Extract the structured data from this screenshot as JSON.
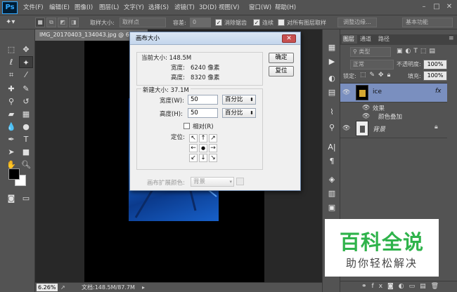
{
  "app": {
    "logo": "Ps"
  },
  "menu": [
    "文件(F)",
    "编辑(E)",
    "图像(I)",
    "图层(L)",
    "文字(Y)",
    "选择(S)",
    "滤镜(T)",
    "3D(D)",
    "视图(V)",
    "窗口(W)",
    "帮助(H)"
  ],
  "window_controls": [
    "–",
    "□",
    "✕"
  ],
  "options": {
    "sample_size_label": "取样大小:",
    "sample_size_value": "取样点",
    "tolerance_label": "容差:",
    "tolerance_value": "0",
    "antialias_label": "消除锯齿",
    "contiguous_label": "连续",
    "all_layers_label": "对所有图层取样",
    "refine_edge": "调整边缘...",
    "workspace": "基本功能"
  },
  "document": {
    "tab_title": "IMG_20170403_134043.jpg @ 6.26%",
    "zoom": "6.26%",
    "doc_info": "文档:148.5M/87.7M"
  },
  "dialog": {
    "title": "画布大小",
    "current_size_label": "当前大小: 148.5M",
    "width_label": "宽度:",
    "width_value": "6240 像素",
    "height_label": "高度:",
    "height_value": "8320 像素",
    "new_size_label": "新建大小: 37.1M",
    "new_width_label": "宽度(W):",
    "new_width_value": "50",
    "new_width_unit": "百分比",
    "new_height_label": "高度(H):",
    "new_height_value": "50",
    "new_height_unit": "百分比",
    "relative_label": "相对(R)",
    "anchor_label": "定位:",
    "anchor_arrows": [
      "↖",
      "↑",
      "↗",
      "←",
      "●",
      "→",
      "↙",
      "↓",
      "↘"
    ],
    "ext_color_label": "画布扩展颜色:",
    "ext_color_value": "背景",
    "ok": "确定",
    "reset": "复位"
  },
  "layers_panel": {
    "tabs": [
      "图层",
      "通道",
      "路径"
    ],
    "filter_kind": "类型",
    "blend_mode": "正常",
    "opacity_label": "不透明度:",
    "opacity_value": "100%",
    "lock_label": "锁定:",
    "fill_label": "填充:",
    "fill_value": "100%",
    "layers": [
      {
        "name": "ice",
        "fx": "fx"
      },
      {
        "name": "背景"
      }
    ],
    "effects_label": "效果",
    "color_overlay_label": "颜色叠加"
  },
  "watermark": {
    "line1": "百科全说",
    "line2": "助你轻松解决"
  },
  "colors": {
    "selected_layer": "#7a8fbf",
    "dialog_border": "#6b86aa"
  }
}
